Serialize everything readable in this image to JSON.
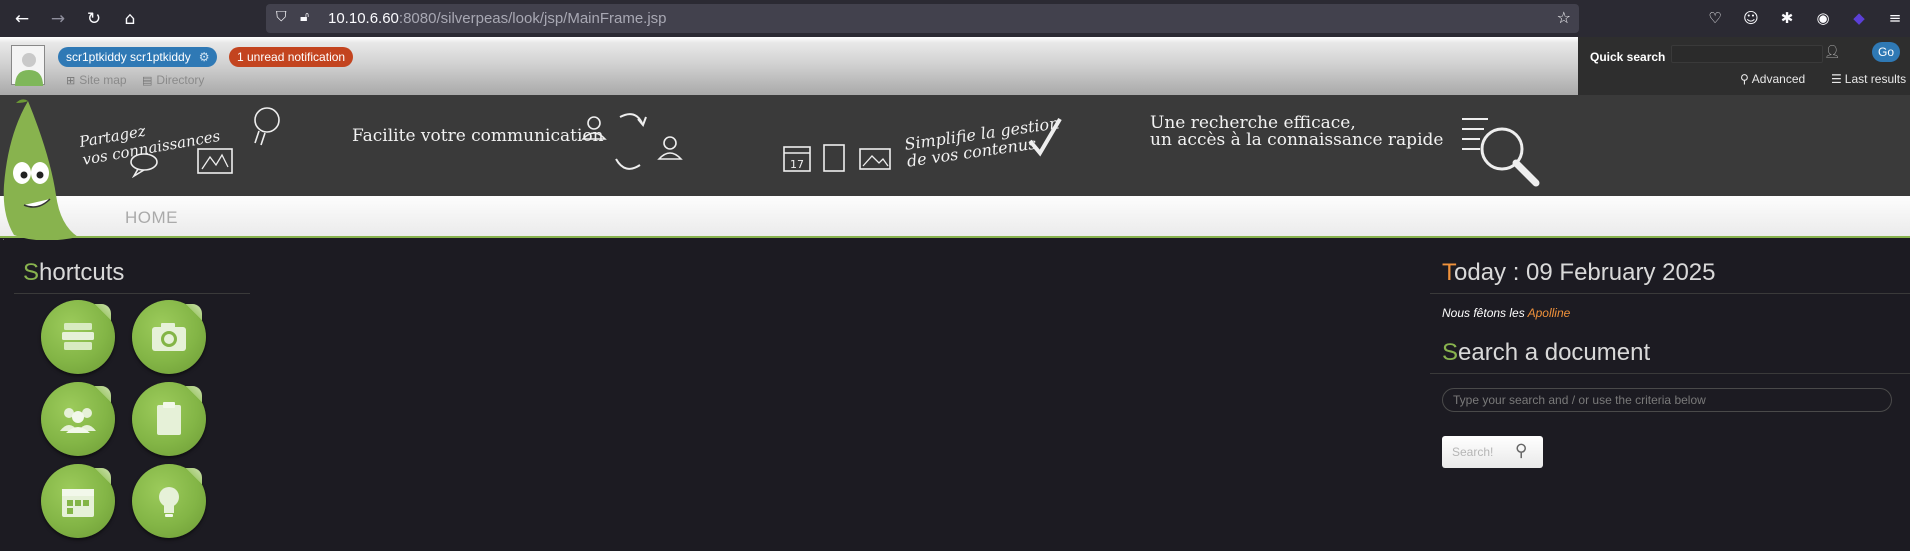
{
  "browser": {
    "url_host": "10.10.6.60",
    "url_rest": ":8080/silverpeas/look/jsp/MainFrame.jsp"
  },
  "header": {
    "user_name": "scr1ptkiddy scr1ptkiddy",
    "notification": "1 unread notification",
    "site_map": "Site map",
    "directory": "Directory"
  },
  "quick_search": {
    "label": "Quick search",
    "go": "Go",
    "advanced": "Advanced",
    "last_results": "Last results"
  },
  "banner": {
    "text1_line1": "Partagez",
    "text1_line2": "vos connaissances",
    "text2": "Facilite votre communication",
    "text3_line1": "Simplifie la gestion",
    "text3_line2": "de vos contenus",
    "text4_line1": "Une recherche efficace,",
    "text4_line2": "un accès à la connaissance rapide",
    "calendar_day": "17"
  },
  "menu": {
    "home": "HOME"
  },
  "shortcuts": {
    "title_first": "S",
    "title_rest": "hortcuts",
    "items": [
      {
        "icon": "books-icon"
      },
      {
        "icon": "camera-icon"
      },
      {
        "icon": "group-icon"
      },
      {
        "icon": "clipboard-icon"
      },
      {
        "icon": "calendar-icon"
      },
      {
        "icon": "lightbulb-icon"
      }
    ]
  },
  "today": {
    "title_first": "T",
    "title_rest": "oday : 09 February 2025",
    "feast_prefix": "Nous fêtons les ",
    "feast_name": "Apolline"
  },
  "search_doc": {
    "title_first": "S",
    "title_rest": "earch a document",
    "placeholder": "Type your search and / or use the criteria below",
    "button": "Search!"
  },
  "colors": {
    "accent_green": "#88b34e",
    "accent_orange": "#f0923b",
    "user_blue": "#2f79b5",
    "notif_red": "#c3441f"
  }
}
